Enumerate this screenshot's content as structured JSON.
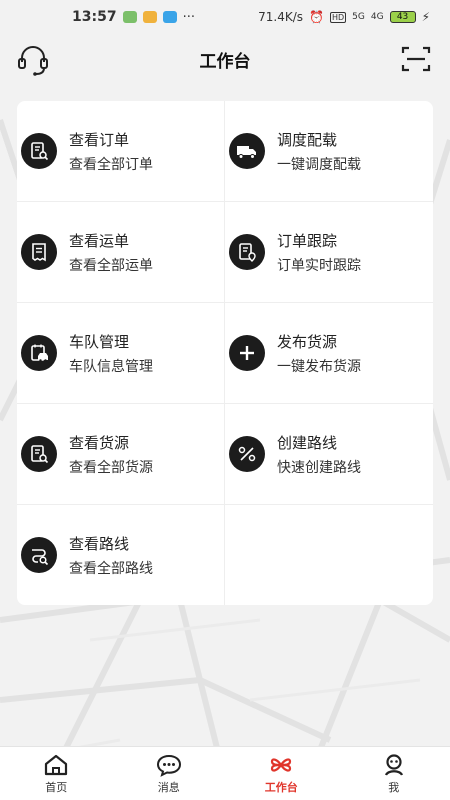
{
  "status_bar": {
    "time": "13:57",
    "dots": "···",
    "net_speed": "71.4K/s",
    "hd": "HD",
    "signal_1": "5G",
    "signal_2": "4G",
    "battery": "43"
  },
  "header": {
    "title": "工作台",
    "left_icon": "headset-icon",
    "right_icon": "scan-icon"
  },
  "grid": {
    "items": [
      {
        "title": "查看订单",
        "subtitle": "查看全部订单",
        "icon": "order-search-icon"
      },
      {
        "title": "调度配载",
        "subtitle": "一键调度配载",
        "icon": "truck-icon"
      },
      {
        "title": "查看运单",
        "subtitle": "查看全部运单",
        "icon": "waybill-icon"
      },
      {
        "title": "订单跟踪",
        "subtitle": "订单实时跟踪",
        "icon": "tracking-icon"
      },
      {
        "title": "车队管理",
        "subtitle": "车队信息管理",
        "icon": "fleet-icon"
      },
      {
        "title": "发布货源",
        "subtitle": "一键发布货源",
        "icon": "plus-icon"
      },
      {
        "title": "查看货源",
        "subtitle": "查看全部货源",
        "icon": "cargo-search-icon"
      },
      {
        "title": "创建路线",
        "subtitle": "快速创建路线",
        "icon": "route-create-icon"
      },
      {
        "title": "查看路线",
        "subtitle": "查看全部路线",
        "icon": "route-search-icon"
      }
    ]
  },
  "tabbar": {
    "items": [
      {
        "label": "首页",
        "icon": "home-icon"
      },
      {
        "label": "消息",
        "icon": "message-icon"
      },
      {
        "label": "工作台",
        "icon": "workbench-icon",
        "active": true
      },
      {
        "label": "我",
        "icon": "profile-icon"
      }
    ]
  },
  "colors": {
    "accent": "#e0352b",
    "icon_bg": "#1c1c1c",
    "background": "#f2f2f2"
  }
}
